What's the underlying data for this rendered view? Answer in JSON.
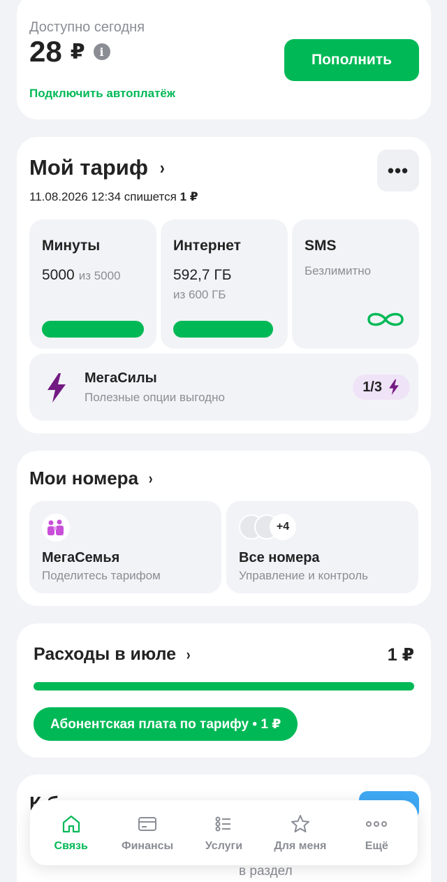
{
  "colors": {
    "accent": "#00b956",
    "background": "#f2f3f7",
    "muted": "#8a8d94",
    "purple": "#731982"
  },
  "balance": {
    "label": "Доступно сегодня",
    "amount": "28",
    "currency": "₽",
    "info_icon": "i",
    "autopay_link": "Подключить автоплатёж",
    "topup_button": "Пополнить"
  },
  "tariff": {
    "title": "Мой тариф",
    "chevron": "›",
    "more_icon": "•••",
    "charge_text": "11.08.2026 12:34 спишется",
    "charge_amount": "1 ₽",
    "minutes": {
      "title": "Минуты",
      "value": "5000",
      "total": "из 5000",
      "remaining_fraction": 1.0
    },
    "internet": {
      "title": "Интернет",
      "value": "592,7 ГБ",
      "total": "из 600 ГБ",
      "remaining_fraction": 0.988
    },
    "sms": {
      "title": "SMS",
      "subtitle": "Безлимитно",
      "icon": "infinity-icon"
    },
    "megasily": {
      "title": "МегаСилы",
      "subtitle": "Полезные опции выгодно",
      "badge": "1/3"
    }
  },
  "numbers": {
    "title": "Мои номера",
    "chevron": "›",
    "family": {
      "title": "МегаСемья",
      "subtitle": "Поделитесь тарифом"
    },
    "all": {
      "title": "Все номера",
      "subtitle": "Управление и контроль",
      "count_badge": "+4"
    }
  },
  "expenses": {
    "title": "Расходы в июле",
    "chevron": "›",
    "total": "1 ₽",
    "chip": "Абонентская плата по тарифу • 1 ₽"
  },
  "next_section": {
    "title_partial": "К      б",
    "link_partial": "в раздел"
  },
  "nav": {
    "items": [
      {
        "label": "Связь",
        "icon": "home-icon",
        "active": true
      },
      {
        "label": "Финансы",
        "icon": "card-icon",
        "active": false
      },
      {
        "label": "Услуги",
        "icon": "list-icon",
        "active": false
      },
      {
        "label": "Для меня",
        "icon": "star-icon",
        "active": false
      },
      {
        "label": "Ещё",
        "icon": "more-dots-icon",
        "active": false
      }
    ]
  }
}
